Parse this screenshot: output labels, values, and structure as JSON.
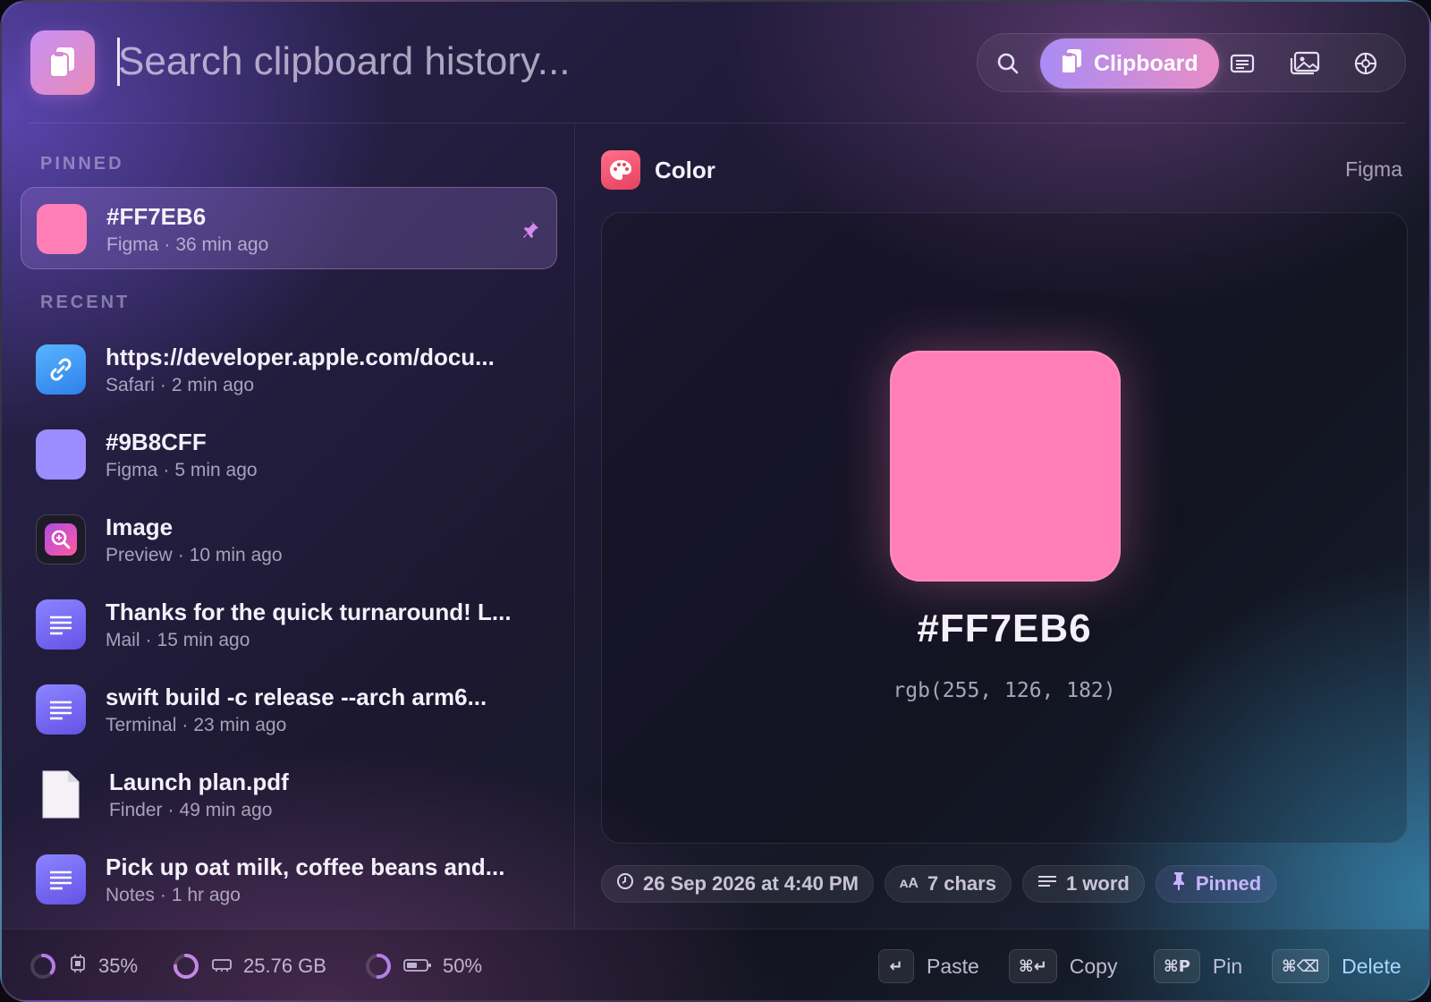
{
  "search": {
    "placeholder": "Search clipboard history..."
  },
  "toolbar": {
    "active_tab_label": "Clipboard"
  },
  "sections": {
    "pinned": "PINNED",
    "recent": "RECENT"
  },
  "pinned": [
    {
      "title": "#FF7EB6",
      "app": "Figma",
      "time": "36 min ago",
      "swatch": "#FF7EB6"
    }
  ],
  "recent": [
    {
      "title": "https://developer.apple.com/docu...",
      "app": "Safari",
      "time": "2 min ago",
      "kind": "link"
    },
    {
      "title": "#9B8CFF",
      "app": "Figma",
      "time": "5 min ago",
      "kind": "color",
      "swatch": "#9B8CFF"
    },
    {
      "title": "Image",
      "app": "Preview",
      "time": "10 min ago",
      "kind": "image"
    },
    {
      "title": "Thanks for the quick turnaround! L...",
      "app": "Mail",
      "time": "15 min ago",
      "kind": "text"
    },
    {
      "title": "swift build -c release --arch arm6...",
      "app": "Terminal",
      "time": "23 min ago",
      "kind": "text"
    },
    {
      "title": "Launch plan.pdf",
      "app": "Finder",
      "time": "49 min ago",
      "kind": "file"
    },
    {
      "title": "Pick up oat milk, coffee beans and...",
      "app": "Notes",
      "time": "1 hr ago",
      "kind": "text"
    }
  ],
  "meta_separator": "·",
  "detail": {
    "type": "Color",
    "source": "Figma",
    "hex": "#FF7EB6",
    "rgb": "rgb(255, 126, 182)",
    "chips": {
      "date": "26 Sep 2026 at 4:40 PM",
      "chars": "7 chars",
      "words": "1 word",
      "pinned": "Pinned"
    }
  },
  "status": {
    "cpu": "35%",
    "memory": "25.76 GB",
    "battery": "50%",
    "cpu_fraction": 0.35,
    "memory_fraction": 0.75,
    "battery_fraction": 0.5
  },
  "shortcuts": [
    {
      "keys": "↵",
      "label": "Paste"
    },
    {
      "keys": "⌘↵",
      "label": "Copy"
    },
    {
      "keys": "⌘P",
      "label": "Pin"
    },
    {
      "keys": "⌘⌫",
      "label": "Delete"
    }
  ],
  "colors": {
    "accent_purple": "#A98CF4",
    "accent_pink": "#E98DC6",
    "selected_swatch": "#FF7EB6",
    "secondary_swatch": "#9B8CFF"
  },
  "icons": {
    "app": "clipboard-icon",
    "toolbar": [
      "search-icon",
      "clipboard-icon",
      "text-list-icon",
      "photos-icon",
      "color-wheel-icon"
    ],
    "detail_type": "palette-icon"
  }
}
